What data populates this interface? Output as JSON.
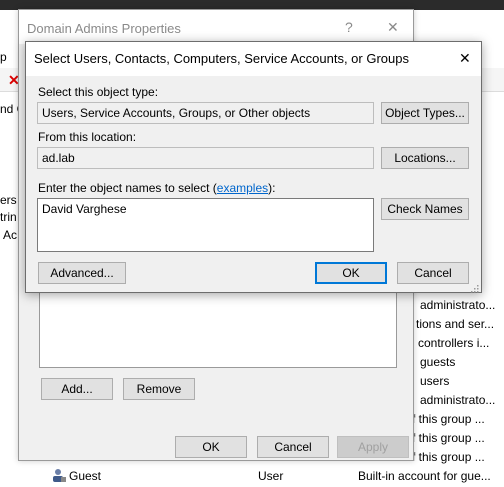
{
  "background": {
    "toolbar_fragment": "p",
    "left_fragments": [
      "nd C",
      "ers",
      "trin",
      "Ac"
    ],
    "list_descriptions": [
      "administrato...",
      "tions and ser...",
      "controllers i...",
      "guests",
      "users",
      "administrato...",
      "f this group ...",
      "f this group ...",
      "f this group ..."
    ],
    "guest_row": {
      "name": "Guest",
      "type": "User",
      "description": "Built-in account for gue..."
    }
  },
  "properties_dialog": {
    "title": "Domain Admins Properties",
    "help_glyph": "?",
    "close_glyph": "✕",
    "add_label": "Add...",
    "remove_label": "Remove",
    "ok_label": "OK",
    "cancel_label": "Cancel",
    "apply_label": "Apply"
  },
  "select_dialog": {
    "title": "Select Users, Contacts, Computers, Service Accounts, or Groups",
    "close_glyph": "✕",
    "object_type_label": "Select this object type:",
    "object_type_value": "Users, Service Accounts, Groups, or Other objects",
    "object_types_button": "Object Types...",
    "location_label": "From this location:",
    "location_value": "ad.lab",
    "locations_button": "Locations...",
    "names_label_prefix": "Enter the object names to select (",
    "names_label_link": "examples",
    "names_label_suffix": "):",
    "names_value": "David Varghese",
    "check_names_button": "Check Names",
    "advanced_button": "Advanced...",
    "ok_button": "OK",
    "cancel_button": "Cancel"
  },
  "colors": {
    "accent": "#0078d7",
    "link": "#0066cc",
    "dialog_bg": "#f0f0f0"
  }
}
